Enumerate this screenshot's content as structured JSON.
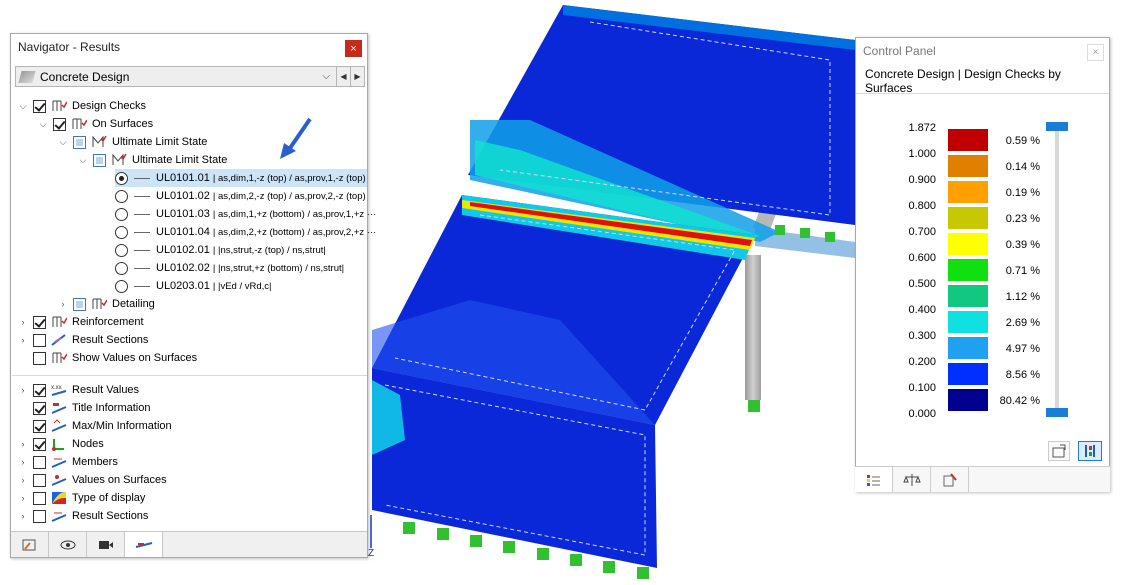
{
  "navigator": {
    "title": "Navigator - Results",
    "close": "×",
    "module": "Concrete Design",
    "tree": [
      {
        "label": "Design Checks",
        "level": 0
      },
      {
        "label": "On Surfaces",
        "level": 1
      },
      {
        "label": "Ultimate Limit State",
        "level": 2
      },
      {
        "label": "Ultimate Limit State",
        "level": 3
      }
    ],
    "checks": [
      {
        "id": "UL0101.01",
        "formula": "| as,dim,1,-z (top) / as,prov,1,-z (top)",
        "selected": true
      },
      {
        "id": "UL0101.02",
        "formula": "| as,dim,2,-z (top) / as,prov,2,-z (top)",
        "selected": false
      },
      {
        "id": "UL0101.03",
        "formula": "| as,dim,1,+z (bottom) / as,prov,1,+z ···",
        "selected": false
      },
      {
        "id": "UL0101.04",
        "formula": "| as,dim,2,+z (bottom) / as,prov,2,+z ···",
        "selected": false
      },
      {
        "id": "UL0102.01",
        "formula": "| |ns,strut,-z (top) / ns,strut|",
        "selected": false
      },
      {
        "id": "UL0102.02",
        "formula": "| |ns,strut,+z (bottom) / ns,strut|",
        "selected": false
      },
      {
        "id": "UL0203.01",
        "formula": "| |vEd / vRd,c|",
        "selected": false
      }
    ],
    "detailing": "Detailing",
    "group1": [
      {
        "label": "Reinforcement",
        "checked": true
      },
      {
        "label": "Result Sections",
        "checked": false
      },
      {
        "label": "Show Values on Surfaces",
        "checked": false
      }
    ],
    "group2": [
      {
        "label": "Result Values",
        "checked": true
      },
      {
        "label": "Title Information",
        "checked": true
      },
      {
        "label": "Max/Min Information",
        "checked": true
      },
      {
        "label": "Nodes",
        "checked": true
      },
      {
        "label": "Members",
        "checked": false
      },
      {
        "label": "Values on Surfaces",
        "checked": false
      },
      {
        "label": "Type of display",
        "checked": false
      },
      {
        "label": "Result Sections",
        "checked": false
      }
    ]
  },
  "control_panel": {
    "title": "Control Panel",
    "close": "×",
    "subtitle": "Concrete Design | Design Checks by Surfaces",
    "legend": [
      {
        "value": "1.872",
        "color": "#c00000",
        "pct": "0.59 %"
      },
      {
        "value": "1.000",
        "color": "#e08000",
        "pct": "0.14 %"
      },
      {
        "value": "0.900",
        "color": "#ffa000",
        "pct": "0.19 %"
      },
      {
        "value": "0.800",
        "color": "#c8c800",
        "pct": "0.23 %"
      },
      {
        "value": "0.700",
        "color": "#ffff00",
        "pct": "0.39 %"
      },
      {
        "value": "0.600",
        "color": "#10e010",
        "pct": "0.71 %"
      },
      {
        "value": "0.500",
        "color": "#10c880",
        "pct": "1.12 %"
      },
      {
        "value": "0.400",
        "color": "#10e0e0",
        "pct": "2.69 %"
      },
      {
        "value": "0.300",
        "color": "#20a0f0",
        "pct": "4.97 %"
      },
      {
        "value": "0.200",
        "color": "#0030ff",
        "pct": "8.56 %"
      },
      {
        "value": "0.100",
        "color": "#000090",
        "pct": "80.42 %"
      },
      {
        "value": "0.000",
        "color": "",
        "pct": ""
      }
    ]
  },
  "axis_label": "Z"
}
